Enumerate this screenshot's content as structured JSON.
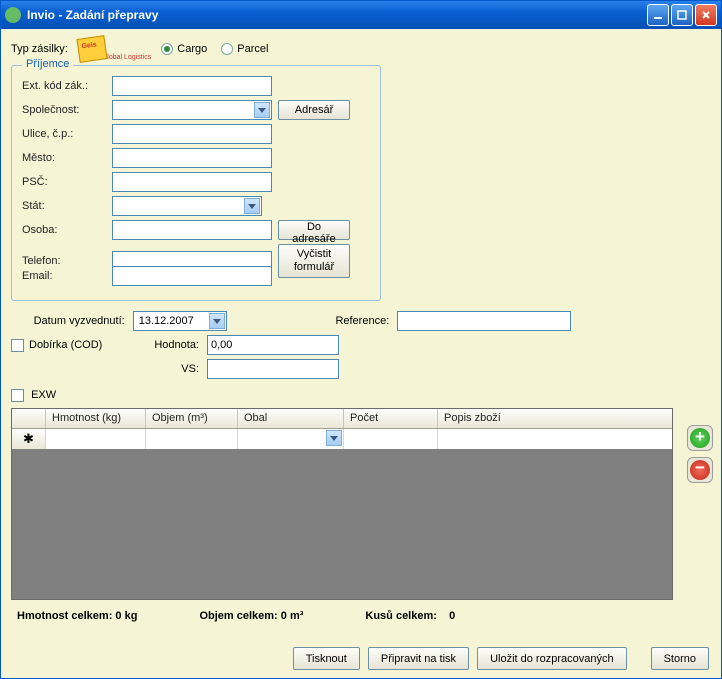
{
  "window": {
    "title": "Invio - Zadání  přepravy"
  },
  "top": {
    "type_label": "Typ zásilky:",
    "logo_sub": "Global Logistics",
    "radio_cargo": "Cargo",
    "radio_parcel": "Parcel",
    "selected": "cargo"
  },
  "recipient": {
    "legend": "Příjemce",
    "fields": {
      "ext_code_label": "Ext. kód zák.:",
      "company_label": "Společnost:",
      "street_label": "Ulice, č.p.:",
      "city_label": "Město:",
      "zip_label": "PSČ:",
      "state_label": "Stát:",
      "person_label": "Osoba:",
      "phone_label": "Telefon:",
      "email_label": "Email:",
      "ext_code": "",
      "company": "",
      "street": "",
      "city": "",
      "zip": "",
      "state": "",
      "person": "",
      "phone": "",
      "email": ""
    },
    "buttons": {
      "addressbook": "Adresář",
      "to_addressbook": "Do adresáře",
      "clear_form": "Vyčistit formulář"
    }
  },
  "pickup": {
    "date_label": "Datum vyzvednutí:",
    "date_value": "13.12.2007",
    "reference_label": "Reference:",
    "reference_value": ""
  },
  "cod": {
    "checkbox_label": "Dobírka (COD)",
    "value_label": "Hodnota:",
    "value": "0,00",
    "vs_label": "VS:",
    "vs": ""
  },
  "exw": {
    "label": "EXW"
  },
  "grid": {
    "columns": {
      "weight": "Hmotnost (kg)",
      "volume": "Objem (m³)",
      "packing": "Obal",
      "count": "Počet",
      "desc": "Popis zboží"
    }
  },
  "totals": {
    "weight_label": "Hmotnost celkem:",
    "weight_value": "0 kg",
    "volume_label": "Objem celkem:",
    "volume_value": "0 m³",
    "pieces_label": "Kusů celkem:",
    "pieces_value": "0"
  },
  "footer": {
    "print": "Tisknout",
    "prepare": "Připravit na tisk",
    "save_draft": "Uložit do rozpracovaných",
    "cancel": "Storno"
  }
}
